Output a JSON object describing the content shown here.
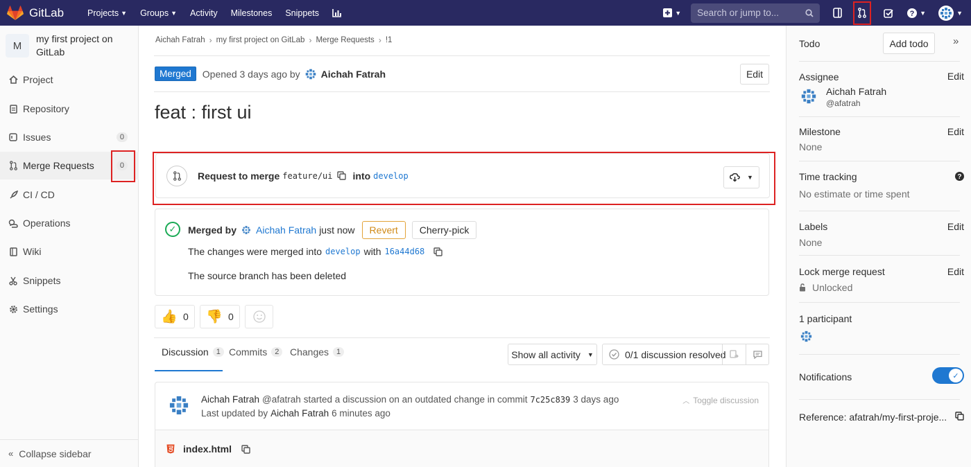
{
  "topnav": {
    "brand": "GitLab",
    "links": [
      {
        "label": "Projects",
        "dropdown": true
      },
      {
        "label": "Groups",
        "dropdown": true
      },
      {
        "label": "Activity",
        "dropdown": false
      },
      {
        "label": "Milestones",
        "dropdown": false
      },
      {
        "label": "Snippets",
        "dropdown": false
      }
    ],
    "search_placeholder": "Search or jump to..."
  },
  "sidebar": {
    "project_initial": "M",
    "project_name": "my first project on GitLab",
    "items": [
      {
        "label": "Project",
        "icon": "home-icon"
      },
      {
        "label": "Repository",
        "icon": "file-icon"
      },
      {
        "label": "Issues",
        "icon": "issues-icon",
        "badge": "0"
      },
      {
        "label": "Merge Requests",
        "icon": "merge-request-icon",
        "badge": "0"
      },
      {
        "label": "CI / CD",
        "icon": "rocket-icon"
      },
      {
        "label": "Operations",
        "icon": "cloud-gear-icon"
      },
      {
        "label": "Wiki",
        "icon": "book-icon"
      },
      {
        "label": "Snippets",
        "icon": "scissors-icon"
      },
      {
        "label": "Settings",
        "icon": "gear-icon"
      }
    ],
    "collapse_label": "Collapse sidebar"
  },
  "breadcrumb": [
    "Aichah Fatrah",
    "my first project on GitLab",
    "Merge Requests",
    "!1"
  ],
  "mr": {
    "status": "Merged",
    "opened_text": "Opened 3 days ago by",
    "author": "Aichah Fatrah",
    "edit_label": "Edit",
    "title": "feat : first ui",
    "request_prefix": "Request to merge",
    "source_branch": "feature/ui",
    "into_label": "into",
    "target_branch": "develop",
    "merged_by_label": "Merged by",
    "merged_by": "Aichah Fatrah",
    "merged_when": "just now",
    "revert_label": "Revert",
    "cherry_pick_label": "Cherry-pick",
    "changes_prefix": "The changes were merged into",
    "changes_branch": "develop",
    "changes_with": "with",
    "commit_sha": "16a44d68",
    "source_deleted": "The source branch has been deleted",
    "thumbs_up": "0",
    "thumbs_down": "0"
  },
  "tabs": [
    {
      "label": "Discussion",
      "count": "1"
    },
    {
      "label": "Commits",
      "count": "2"
    },
    {
      "label": "Changes",
      "count": "1"
    }
  ],
  "activity_filter": "Show all activity",
  "resolved": "0/1 discussion resolved",
  "discussion": {
    "author": "Aichah Fatrah",
    "handle": "@afatrah",
    "started_text": "started a discussion on an outdated change in commit",
    "commit": "7c25c839",
    "time": "3 days ago",
    "toggle_label": "Toggle discussion",
    "updated_prefix": "Last updated by",
    "updated_by": "Aichah Fatrah",
    "updated_time": "6 minutes ago",
    "file": "index.html"
  },
  "right_sidebar": {
    "todo_label": "Todo",
    "add_todo_label": "Add todo",
    "assignee_label": "Assignee",
    "assignee_name": "Aichah Fatrah",
    "assignee_handle": "@afatrah",
    "edit_label": "Edit",
    "milestone_label": "Milestone",
    "milestone_value": "None",
    "time_tracking_label": "Time tracking",
    "time_tracking_value": "No estimate or time spent",
    "labels_label": "Labels",
    "labels_value": "None",
    "lock_label": "Lock merge request",
    "lock_value": "Unlocked",
    "participants_label": "1 participant",
    "notifications_label": "Notifications",
    "notifications_on": true,
    "reference_label": "Reference: afatrah/my-first-proje..."
  },
  "colors": {
    "topbar": "#292961",
    "accent": "#1f78d1",
    "merged": "#1f78d1",
    "success": "#1aaa55",
    "highlight": "#dd2222"
  }
}
